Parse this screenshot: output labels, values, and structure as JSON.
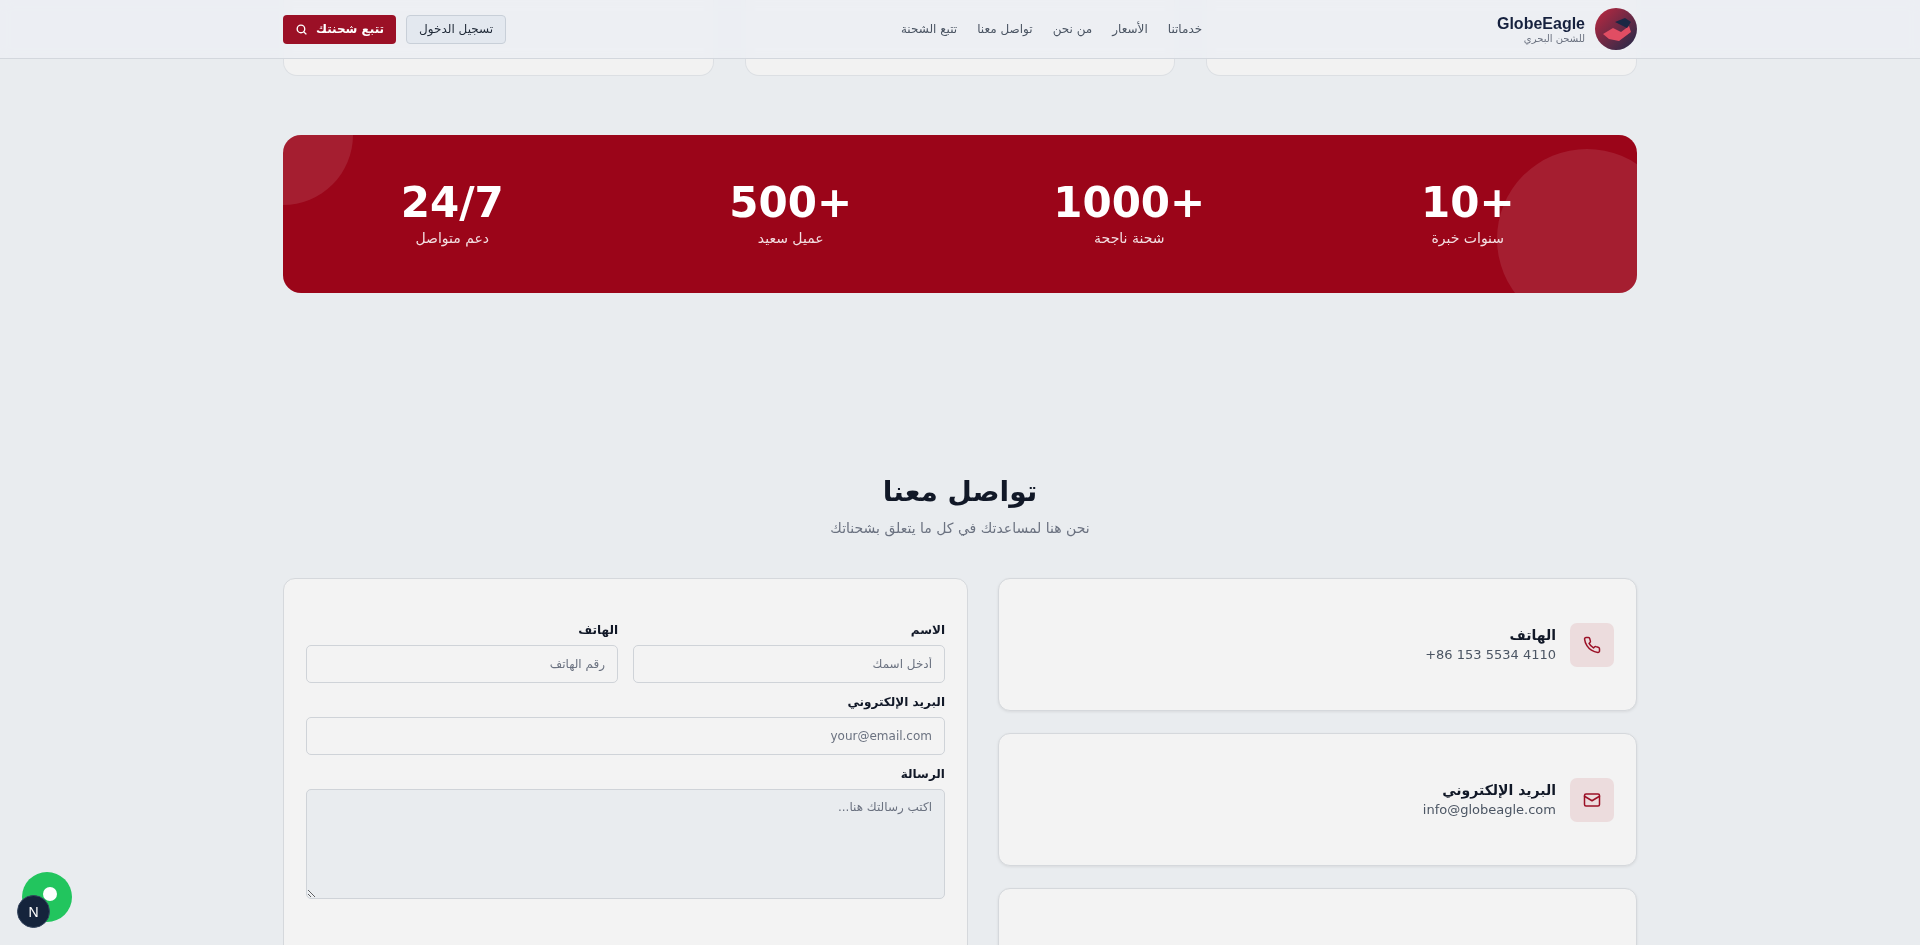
{
  "header": {
    "brand": {
      "name": "GlobeEagle",
      "tagline": "للشحن البحري"
    },
    "nav": [
      {
        "label": "خدماتنا"
      },
      {
        "label": "الأسعار"
      },
      {
        "label": "من نحن"
      },
      {
        "label": "تواصل معنا"
      },
      {
        "label": "تتبع الشحنة"
      }
    ],
    "buttons": [
      {
        "kind": "outline",
        "label": "تسجيل الدخول"
      },
      {
        "kind": "primary",
        "label": "تتبع شحنتك"
      }
    ]
  },
  "top_cards": [
    {
      "kind": "card"
    },
    {
      "kind": "card"
    },
    {
      "kind": "card"
    }
  ],
  "stats": [
    {
      "value": "10+",
      "label": "سنوات خبرة"
    },
    {
      "value": "1000+",
      "label": "شحنة ناجحة"
    },
    {
      "value": "500+",
      "label": "عميل سعيد"
    },
    {
      "value": "24/7",
      "label": "دعم متواصل"
    }
  ],
  "contact": {
    "title": "تواصل معنا",
    "subtitle": "نحن هنا لمساعدتك في كل ما يتعلق بشحناتك",
    "info": [
      {
        "kind": "phone",
        "title": "الهاتف",
        "value": "+86 153 5534 4110"
      },
      {
        "kind": "email",
        "title": "البريد الإلكتروني",
        "value": "info@globeagle.com"
      },
      {
        "kind": "blank"
      }
    ],
    "form": {
      "row": [
        {
          "label": "الاسم",
          "placeholder": "أدخل اسمك"
        },
        {
          "label": "الهاتف",
          "placeholder": "رقم الهاتف"
        }
      ],
      "email": {
        "label": "البريد الإلكتروني",
        "placeholder": "your@email.com"
      },
      "message": {
        "label": "الرسالة",
        "placeholder": "اكتب رسالتك هنا..."
      }
    }
  },
  "dev_badge": {
    "label": "N"
  }
}
